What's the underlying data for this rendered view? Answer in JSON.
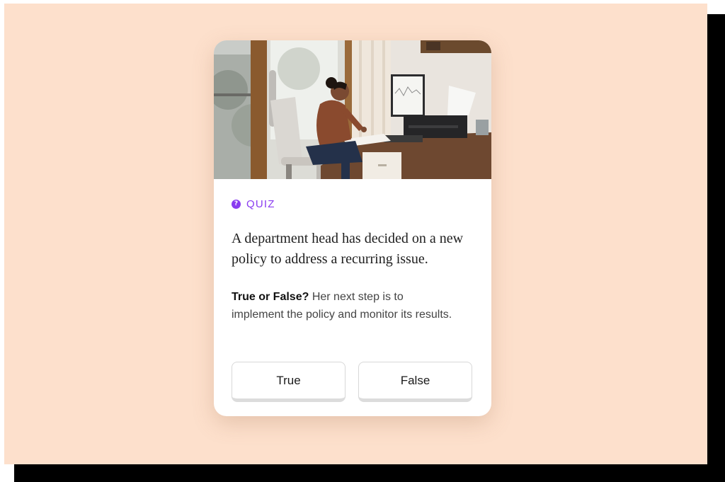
{
  "quiz": {
    "badge_icon": "?",
    "badge_label": "QUIZ",
    "question": "A department head has decided on a new policy to address a recurring issue.",
    "prompt_lead": "True or False?",
    "prompt_text": " Her next step is to implement the policy and monitor its results.",
    "options": [
      "True",
      "False"
    ]
  },
  "colors": {
    "background": "#fde0cc",
    "accent": "#8a3cf0",
    "card": "#ffffff"
  },
  "icons": {
    "badge": "question-circle-icon"
  }
}
